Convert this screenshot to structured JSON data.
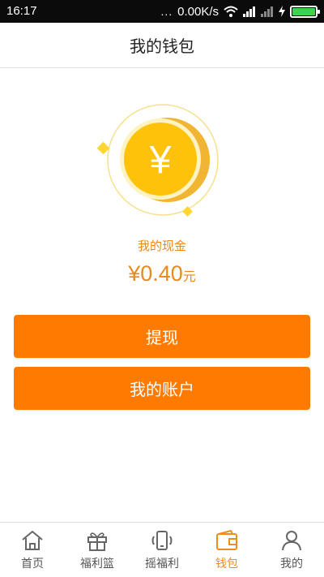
{
  "status_bar": {
    "time": "16:17",
    "dots": "...",
    "speed": "0.00K/s",
    "icons": [
      "wifi-icon",
      "signal-icon",
      "signal-icon",
      "charging-icon",
      "battery-icon"
    ],
    "battery_color": "#3fd24c"
  },
  "header": {
    "title": "我的钱包"
  },
  "wallet": {
    "coin_symbol": "¥",
    "cash_label": "我的现金",
    "cash_value": "¥0.40",
    "cash_unit": "元"
  },
  "actions": {
    "withdraw_label": "提现",
    "account_label": "我的账户",
    "button_color": "#ff7a00"
  },
  "bottom_nav": {
    "items": [
      {
        "label": "首页",
        "icon": "home-icon",
        "active": false
      },
      {
        "label": "福利篮",
        "icon": "gift-icon",
        "active": false
      },
      {
        "label": "摇福利",
        "icon": "shake-phone-icon",
        "active": false
      },
      {
        "label": "钱包",
        "icon": "wallet-icon",
        "active": true
      },
      {
        "label": "我的",
        "icon": "user-icon",
        "active": false
      }
    ],
    "active_color": "#f08c1c",
    "inactive_color": "#555555"
  }
}
